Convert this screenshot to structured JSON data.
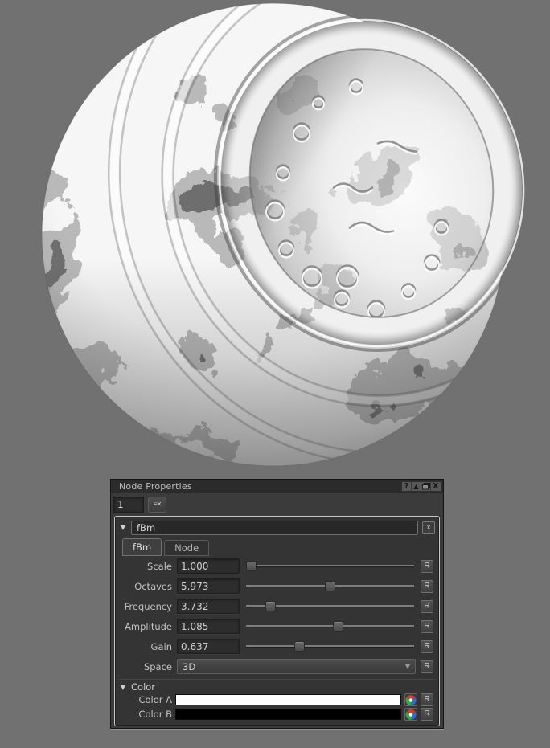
{
  "panel": {
    "title": "Node Properties",
    "window_icons": {
      "help": "?",
      "popup": "▲",
      "close": "X"
    },
    "toolbar": {
      "index_value": "1",
      "clear_glyph": "≡✕"
    }
  },
  "node": {
    "header": {
      "disclosure": "▼",
      "name": "fBm",
      "close": "x"
    },
    "tabs": [
      {
        "label": "fBm"
      },
      {
        "label": "Node"
      }
    ],
    "active_tab": "fBm",
    "reset_label": "R",
    "params": [
      {
        "label": "Scale",
        "value": "1.000",
        "slider_pct": 1
      },
      {
        "label": "Octaves",
        "value": "5.973",
        "slider_pct": 50
      },
      {
        "label": "Frequency",
        "value": "3.732",
        "slider_pct": 13
      },
      {
        "label": "Amplitude",
        "value": "1.085",
        "slider_pct": 55
      },
      {
        "label": "Gain",
        "value": "0.637",
        "slider_pct": 31
      }
    ],
    "space": {
      "label": "Space",
      "value": "3D",
      "arrow": "▼"
    },
    "color_section": {
      "disclosure": "▼",
      "title": "Color",
      "rows": [
        {
          "label": "Color A",
          "hex": "#ffffff"
        },
        {
          "label": "Color B",
          "hex": "#000000"
        }
      ]
    }
  },
  "colors": {
    "background": "#717171",
    "panel_bg": "#3b3b3b",
    "titlebar_bg": "#2b2b2b",
    "texture_black": "#1a1a1a",
    "texture_white": "#f6f6f6"
  }
}
